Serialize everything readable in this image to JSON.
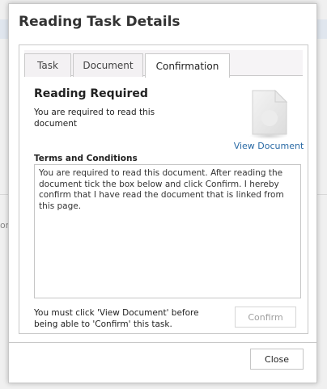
{
  "dialog": {
    "title": "Reading Task Details",
    "tabs": [
      {
        "label": "Task",
        "active": false
      },
      {
        "label": "Document",
        "active": false
      },
      {
        "label": "Confirmation",
        "active": true
      }
    ],
    "confirmation": {
      "heading": "Reading Required",
      "description": "You are required to read this document",
      "view_document_label": "View Document",
      "terms_label": "Terms and Conditions",
      "terms_text": "You are required to read this document. After reading the document tick the box below and click Confirm. I hereby confirm that I have read the document that is linked from this page.",
      "footer_note": "You must click 'View Document' before being able to 'Confirm' this task.",
      "confirm_label": "Confirm",
      "confirm_enabled": false
    },
    "close_label": "Close"
  },
  "background": {
    "glyph": "or"
  },
  "colors": {
    "link": "#2a6aa5",
    "disabled_text": "#a0a0a0",
    "border": "#c9c9c9"
  },
  "icons": {
    "document": "document-icon"
  }
}
